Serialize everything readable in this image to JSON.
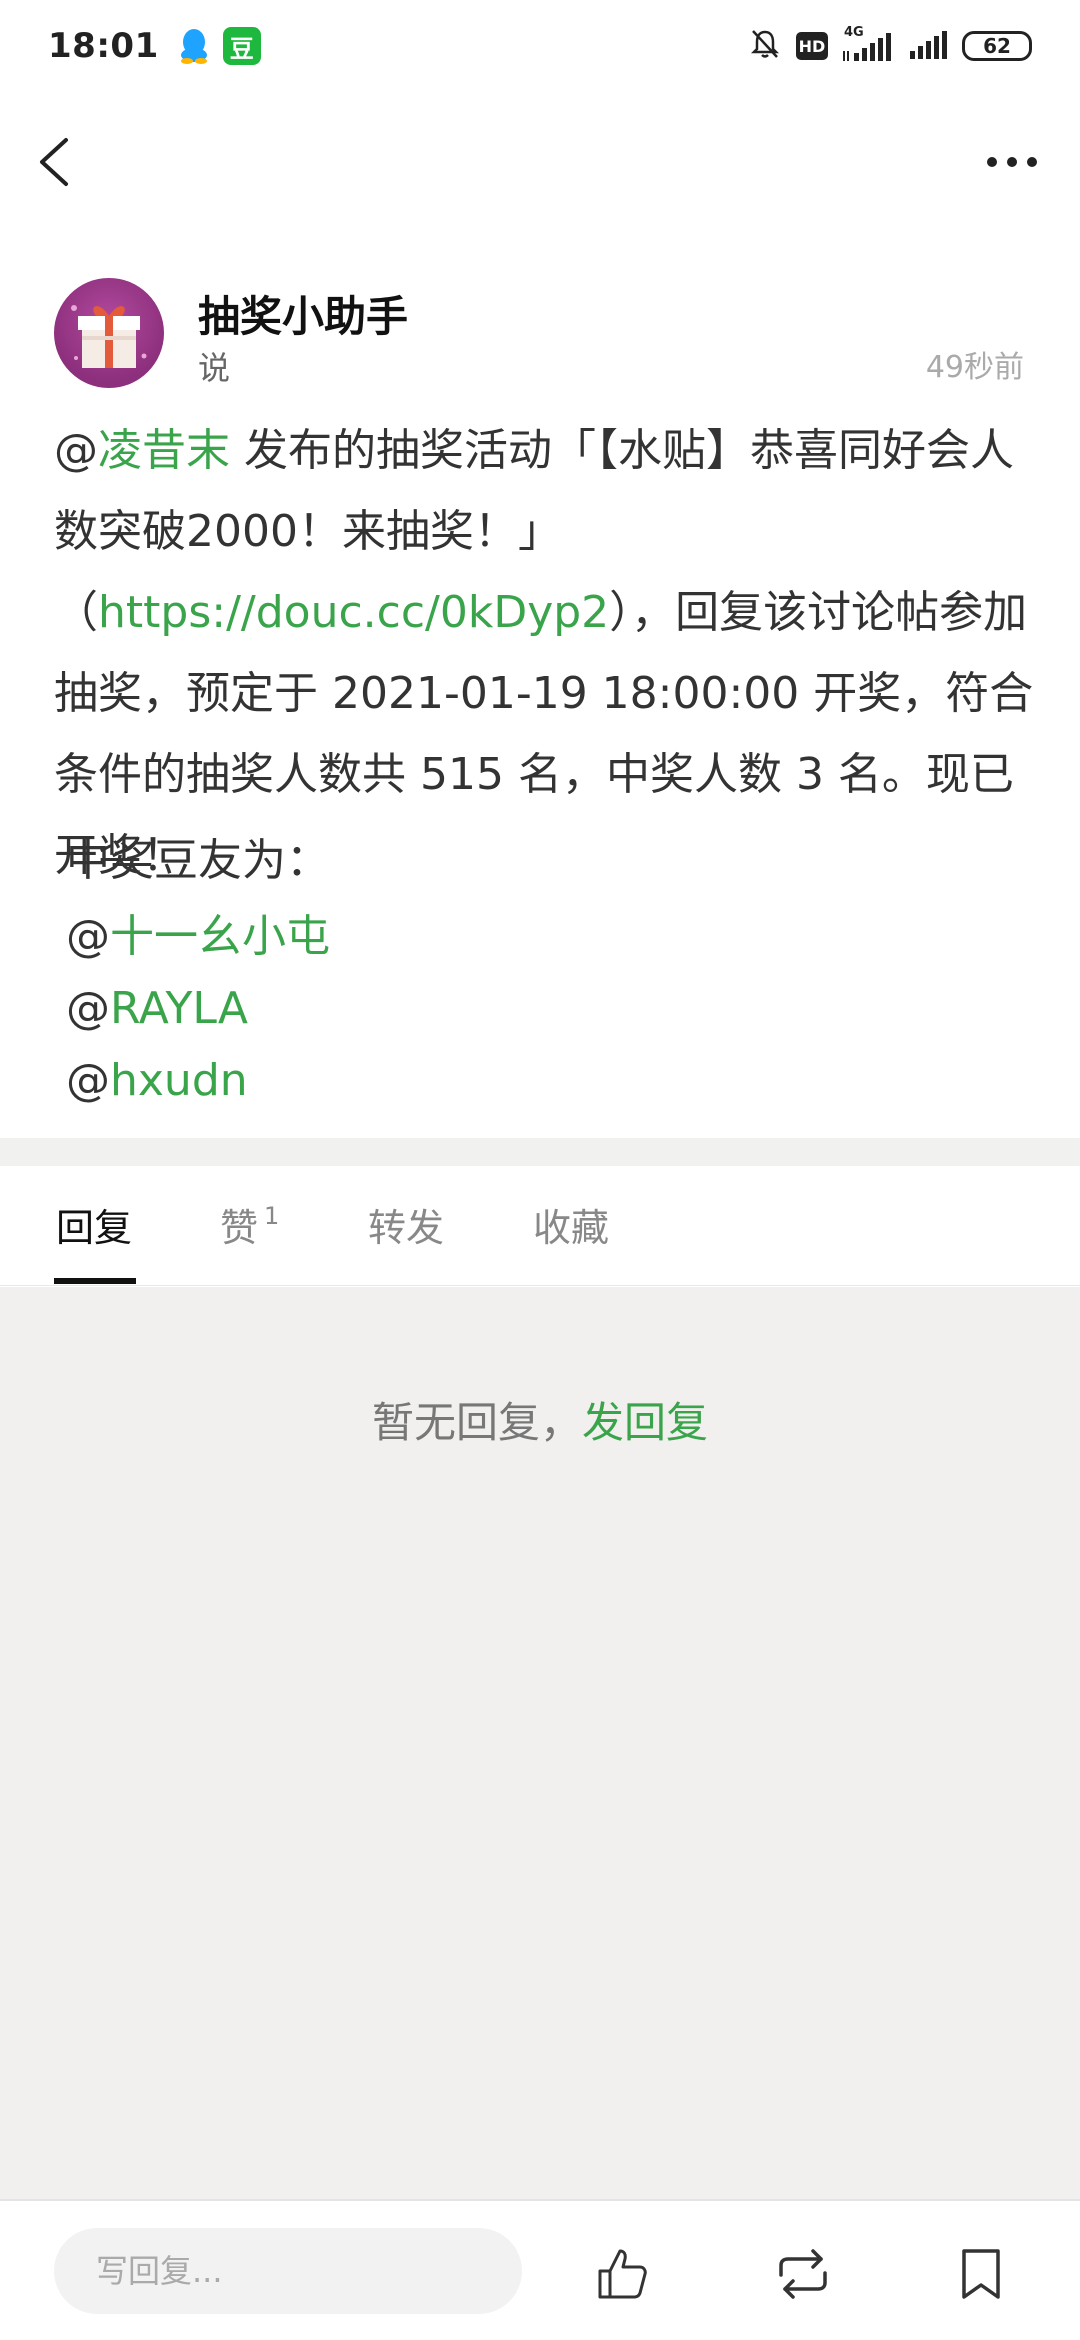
{
  "status_bar": {
    "time": "18:01",
    "dou_label": "豆",
    "hd_label": "HD",
    "network": "4G",
    "battery": "62"
  },
  "post": {
    "author": "抽奖小助手",
    "action": "说",
    "time": "49秒前",
    "segments": [
      {
        "text": "@",
        "link": false
      },
      {
        "text": "凌昔末",
        "link": true
      },
      {
        "text": " 发布的抽奖活动「【水贴】恭喜同好会人数突破2000！来抽奖！」（",
        "link": false
      },
      {
        "text": "https://douc.cc/0kDyp2",
        "link": true
      },
      {
        "text": "），回复该讨论帖参加抽奖，预定于 2021-01-19 18:00:00 开奖，符合条件的抽奖人数共 515 名，中奖人数 3 名。现已开奖！",
        "link": false
      }
    ],
    "winners_title": "中奖豆友为：",
    "winners": [
      "十一幺小屯",
      "RAYLA",
      "hxudn"
    ]
  },
  "tabs": [
    {
      "label": "回复",
      "count": ""
    },
    {
      "label": "赞",
      "count": "1"
    },
    {
      "label": "转发",
      "count": ""
    },
    {
      "label": "收藏",
      "count": ""
    }
  ],
  "empty": {
    "text": "暂无回复，",
    "link": "发回复"
  },
  "bottom_bar": {
    "placeholder": "写回复..."
  },
  "colors": {
    "link": "#3aa44b",
    "reply_bg": "#f1f0ee",
    "avatar": "#8c2f7c"
  }
}
